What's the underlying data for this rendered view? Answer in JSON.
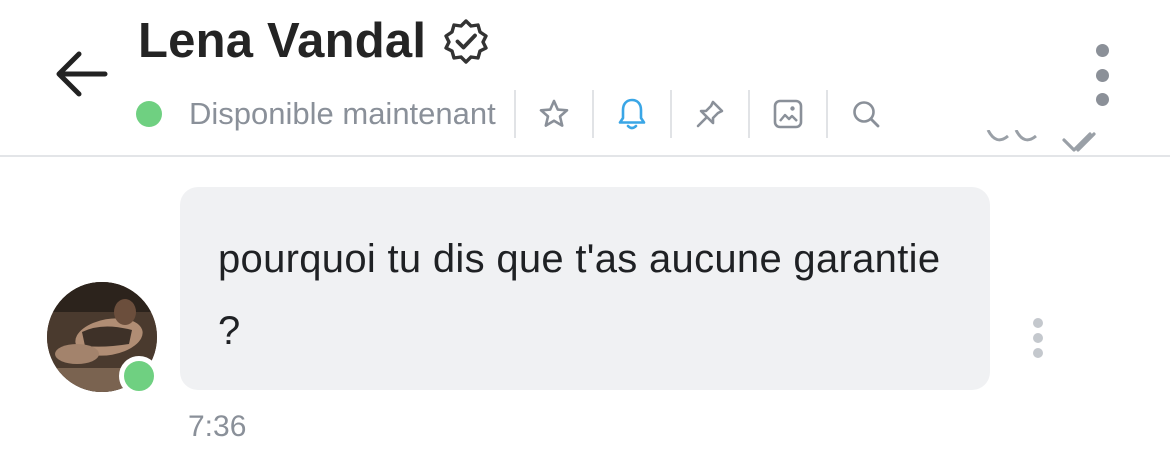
{
  "header": {
    "contact_name": "Lena Vandal",
    "status_text": "Disponible maintenant",
    "icons": {
      "back": "arrow-left-icon",
      "verified": "verified-badge-icon",
      "favorite": "star-icon",
      "notifications": "bell-icon",
      "pin": "pin-icon",
      "media": "image-icon",
      "search": "search-icon",
      "more": "more-vertical-icon"
    }
  },
  "conversation": {
    "messages": [
      {
        "text": "pourquoi tu dis que t'as aucune garantie ?",
        "time": "7:36",
        "sender_online": true
      }
    ]
  },
  "colors": {
    "online": "#6fd081",
    "active_icon": "#3aa6e6",
    "bubble_bg": "#f0f1f3",
    "muted_text": "#8a9099"
  }
}
